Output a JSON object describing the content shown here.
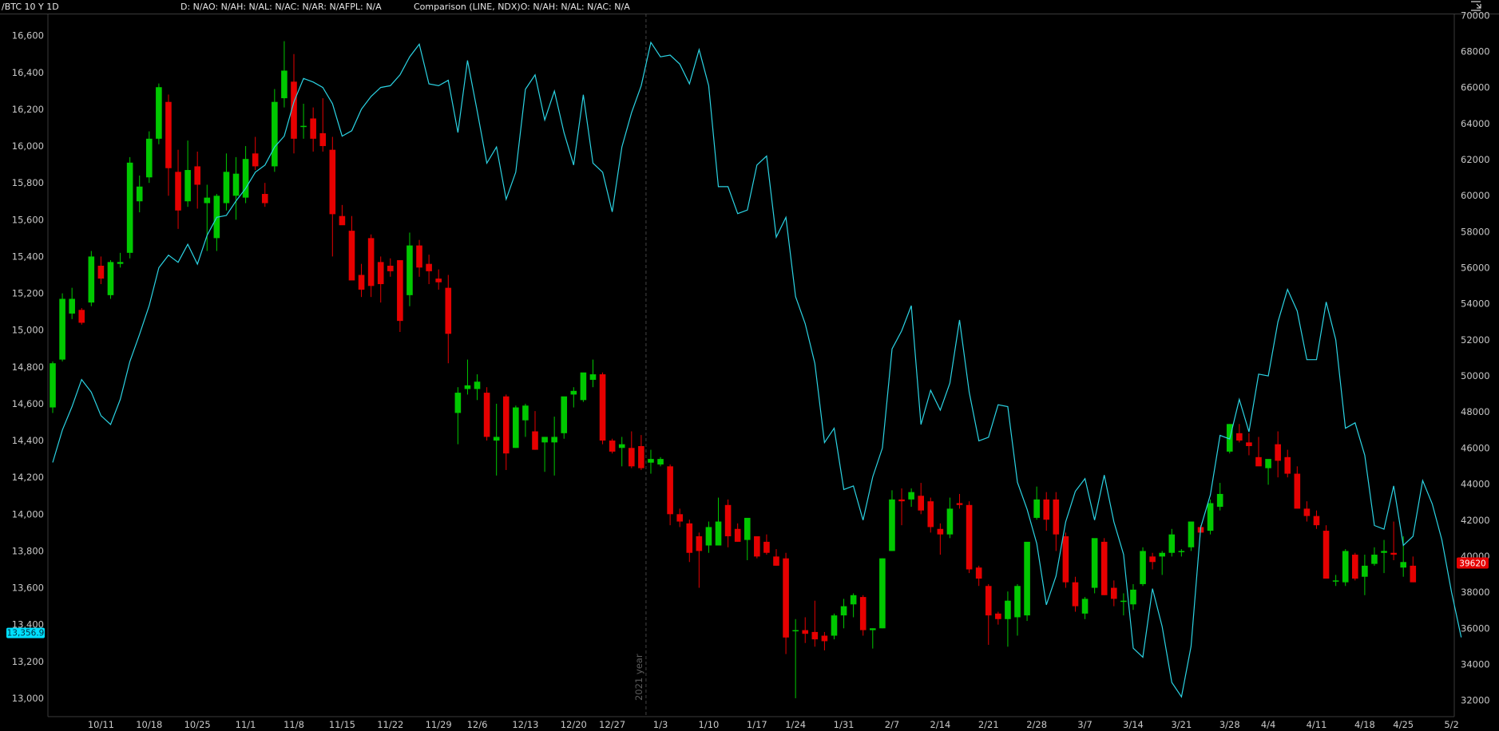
{
  "header": {
    "symbol": "/BTC 10 Y 1D",
    "study": "D: N/AO: N/AH: N/AL: N/AC: N/AR: N/AFPL: N/A",
    "comparison": "Comparison (LINE, NDX)O: N/AH: N/AL: N/AC: N/A",
    "menu_icon": "collapse-corner-icon"
  },
  "colors": {
    "up": "#00c800",
    "down": "#e60000",
    "comparison_line": "#2bd3e3",
    "axis": "#3a3a3a",
    "divider": "#444444",
    "left_badge": "#00e0ff",
    "right_badge": "#e60000"
  },
  "badges": {
    "left_price": "13,356.9",
    "right_price": "39620"
  },
  "divider_label": "2021 year",
  "chart_data": {
    "type": "candlestick",
    "title": "",
    "left_axis": {
      "ticks": [
        "16,600",
        "16,400",
        "16,200",
        "16,000",
        "15,800",
        "15,600",
        "15,400",
        "15,200",
        "15,000",
        "14,800",
        "14,600",
        "14,400",
        "14,200",
        "14,000",
        "13,800",
        "13,600",
        "13,400",
        "13,200",
        "13,000"
      ],
      "range": [
        12900,
        16720
      ]
    },
    "right_axis": {
      "ticks": [
        "70000",
        "68000",
        "66000",
        "64000",
        "62000",
        "60000",
        "58000",
        "56000",
        "54000",
        "52000",
        "50000",
        "48000",
        "46000",
        "44000",
        "42000",
        "40000",
        "38000",
        "36000",
        "34000",
        "32000"
      ],
      "range": [
        31100,
        70100
      ]
    },
    "x_axis": {
      "labels": [
        "10/11",
        "10/18",
        "10/25",
        "11/1",
        "11/8",
        "11/15",
        "11/22",
        "11/29",
        "12/6",
        "12/13",
        "12/20",
        "12/27",
        "1/3",
        "1/10",
        "1/17",
        "1/24",
        "1/31",
        "2/7",
        "2/14",
        "2/21",
        "2/28",
        "3/7",
        "3/14",
        "3/21",
        "3/28",
        "4/4",
        "4/11",
        "4/18",
        "4/25",
        "5/2"
      ],
      "label_bar_index": [
        5,
        10,
        15,
        20,
        25,
        30,
        35,
        40,
        44,
        49,
        54,
        58,
        63,
        68,
        73,
        77,
        82,
        87,
        92,
        97,
        102,
        107,
        112,
        117,
        122,
        126,
        131,
        136,
        140,
        145
      ]
    },
    "series": [
      {
        "name": "/BTC 10 Y 1D",
        "kind": "candlestick",
        "ohlc": [
          [
            14580,
            14830,
            14550,
            14820
          ],
          [
            14840,
            15200,
            14830,
            15170
          ],
          [
            15090,
            15230,
            15060,
            15170
          ],
          [
            15110,
            15120,
            15030,
            15040
          ],
          [
            15150,
            15430,
            15130,
            15400
          ],
          [
            15350,
            15400,
            15250,
            15280
          ],
          [
            15190,
            15380,
            15170,
            15370
          ],
          [
            15360,
            15420,
            15340,
            15370
          ],
          [
            15420,
            15940,
            15390,
            15910
          ],
          [
            15700,
            15840,
            15640,
            15780
          ],
          [
            15830,
            16080,
            15800,
            16040
          ],
          [
            16040,
            16340,
            16010,
            16320
          ],
          [
            16240,
            16280,
            15730,
            15880
          ],
          [
            15860,
            15980,
            15550,
            15650
          ],
          [
            15700,
            16030,
            15670,
            15870
          ],
          [
            15890,
            15970,
            15660,
            15790
          ],
          [
            15690,
            15790,
            15430,
            15720
          ],
          [
            15500,
            15740,
            15430,
            15730
          ],
          [
            15690,
            15960,
            15650,
            15860
          ],
          [
            15730,
            15940,
            15600,
            15850
          ],
          [
            15720,
            16000,
            15690,
            15930
          ],
          [
            15960,
            16050,
            15870,
            15890
          ],
          [
            15740,
            15800,
            15670,
            15690
          ],
          [
            15890,
            16310,
            15860,
            16240
          ],
          [
            16260,
            16570,
            16210,
            16410
          ],
          [
            16350,
            16500,
            15960,
            16040
          ],
          [
            16110,
            16230,
            16040,
            16110
          ],
          [
            16150,
            16210,
            15970,
            16040
          ],
          [
            16070,
            16260,
            15970,
            16000
          ],
          [
            15980,
            16050,
            15400,
            15630
          ],
          [
            15620,
            15680,
            15580,
            15570
          ],
          [
            15540,
            15620,
            15300,
            15270
          ],
          [
            15300,
            15360,
            15180,
            15220
          ],
          [
            15500,
            15520,
            15180,
            15240
          ],
          [
            15370,
            15400,
            15150,
            15250
          ],
          [
            15350,
            15390,
            15290,
            15320
          ],
          [
            15380,
            15380,
            14990,
            15050
          ],
          [
            15190,
            15530,
            15130,
            15460
          ],
          [
            15460,
            15490,
            15290,
            15340
          ],
          [
            15360,
            15410,
            15250,
            15320
          ],
          [
            15280,
            15330,
            15220,
            15260
          ],
          [
            15230,
            15300,
            14820,
            14980
          ],
          [
            14550,
            14690,
            14380,
            14660
          ],
          [
            14680,
            14840,
            14650,
            14700
          ],
          [
            14680,
            14760,
            14620,
            14720
          ],
          [
            14660,
            14690,
            14400,
            14420
          ],
          [
            14400,
            14600,
            14210,
            14420
          ],
          [
            14640,
            14650,
            14240,
            14330
          ],
          [
            14360,
            14590,
            14360,
            14580
          ],
          [
            14510,
            14600,
            14420,
            14590
          ],
          [
            14450,
            14560,
            14350,
            14350
          ],
          [
            14390,
            14420,
            14230,
            14420
          ],
          [
            14390,
            14530,
            14210,
            14420
          ],
          [
            14440,
            14620,
            14410,
            14640
          ],
          [
            14650,
            14690,
            14580,
            14670
          ],
          [
            14620,
            14760,
            14610,
            14770
          ],
          [
            14730,
            14840,
            14690,
            14760
          ],
          [
            14760,
            14770,
            14380,
            14400
          ],
          [
            14400,
            14410,
            14330,
            14340
          ],
          [
            14360,
            14420,
            14260,
            14380
          ],
          [
            14360,
            14450,
            14250,
            14260
          ],
          [
            14370,
            14430,
            14240,
            14250
          ],
          [
            14280,
            14350,
            14220,
            14300
          ],
          [
            14270,
            14310,
            14260,
            14300
          ],
          [
            14260,
            14270,
            13940,
            14000
          ],
          [
            14000,
            14030,
            13930,
            13960
          ],
          [
            13950,
            13970,
            13740,
            13790
          ],
          [
            13880,
            13900,
            13600,
            13800
          ],
          [
            13830,
            13960,
            13790,
            13930
          ],
          [
            13830,
            14090,
            13830,
            13960
          ],
          [
            14050,
            14080,
            13820,
            13880
          ],
          [
            13920,
            13950,
            13850,
            13850
          ],
          [
            13860,
            13950,
            13750,
            13980
          ],
          [
            13880,
            13880,
            13760,
            13770
          ],
          [
            13850,
            13890,
            13780,
            13790
          ],
          [
            13770,
            13810,
            13720,
            13720
          ],
          [
            13760,
            13790,
            13240,
            13330
          ],
          [
            13370,
            13430,
            13000,
            13370
          ],
          [
            13370,
            13440,
            13300,
            13350
          ],
          [
            13360,
            13530,
            13280,
            13320
          ],
          [
            13340,
            13360,
            13260,
            13310
          ],
          [
            13340,
            13460,
            13320,
            13450
          ],
          [
            13450,
            13540,
            13380,
            13500
          ],
          [
            13510,
            13570,
            13440,
            13560
          ],
          [
            13550,
            13560,
            13340,
            13370
          ],
          [
            13370,
            13380,
            13270,
            13380
          ],
          [
            13380,
            13760,
            13380,
            13760
          ],
          [
            13800,
            14130,
            13800,
            14080
          ],
          [
            14080,
            14140,
            13940,
            14070
          ],
          [
            14080,
            14140,
            14040,
            14120
          ],
          [
            14100,
            14170,
            14000,
            14020
          ],
          [
            14070,
            14090,
            13900,
            13930
          ],
          [
            13920,
            13950,
            13780,
            13890
          ],
          [
            13890,
            14090,
            13870,
            14030
          ],
          [
            14060,
            14110,
            14030,
            14050
          ],
          [
            14050,
            14070,
            13680,
            13700
          ],
          [
            13710,
            13720,
            13610,
            13650
          ],
          [
            13610,
            13620,
            13290,
            13450
          ],
          [
            13460,
            13470,
            13400,
            13430
          ],
          [
            13430,
            13580,
            13280,
            13530
          ],
          [
            13440,
            13620,
            13340,
            13610
          ],
          [
            13450,
            13840,
            13420,
            13850
          ],
          [
            13980,
            14150,
            13970,
            14080
          ],
          [
            14080,
            14120,
            13910,
            13970
          ],
          [
            14080,
            14120,
            13800,
            13890
          ],
          [
            13880,
            13900,
            13600,
            13630
          ],
          [
            13630,
            13660,
            13470,
            13500
          ],
          [
            13460,
            13550,
            13430,
            13540
          ],
          [
            13600,
            13850,
            13570,
            13870
          ],
          [
            13850,
            13870,
            13560,
            13560
          ],
          [
            13600,
            13640,
            13500,
            13540
          ],
          [
            13530,
            13570,
            13450,
            13530
          ],
          [
            13510,
            13620,
            13480,
            13590
          ],
          [
            13620,
            13820,
            13610,
            13800
          ],
          [
            13770,
            13790,
            13700,
            13740
          ],
          [
            13770,
            13800,
            13670,
            13790
          ],
          [
            13790,
            13920,
            13770,
            13890
          ],
          [
            13800,
            13810,
            13770,
            13800
          ],
          [
            13820,
            13950,
            13800,
            13960
          ],
          [
            13930,
            13940,
            13900,
            13900
          ],
          [
            13910,
            14080,
            13890,
            14060
          ],
          [
            14040,
            14170,
            14020,
            14110
          ],
          [
            14340,
            14490,
            14330,
            14490
          ],
          [
            14440,
            14490,
            14390,
            14400
          ],
          [
            14390,
            14440,
            14320,
            14370
          ],
          [
            14310,
            14420,
            14300,
            14260
          ],
          [
            14250,
            14260,
            14160,
            14300
          ],
          [
            14380,
            14450,
            14200,
            14290
          ],
          [
            14310,
            14350,
            14200,
            14220
          ],
          [
            14220,
            14260,
            14040,
            14030
          ],
          [
            14030,
            14070,
            13960,
            13990
          ],
          [
            13990,
            14020,
            13920,
            13940
          ],
          [
            13910,
            13940,
            13660,
            13650
          ],
          [
            13640,
            13670,
            13610,
            13640
          ],
          [
            13630,
            13810,
            13610,
            13800
          ],
          [
            13780,
            13790,
            13640,
            13650
          ],
          [
            13660,
            13780,
            13560,
            13720
          ],
          [
            13730,
            13820,
            13720,
            13780
          ],
          [
            13790,
            13860,
            13680,
            13800
          ],
          [
            13790,
            13960,
            13750,
            13780
          ],
          [
            13710,
            13880,
            13660,
            13740
          ],
          [
            13720,
            13770,
            13630,
            13630
          ]
        ]
      },
      {
        "name": "NDX",
        "kind": "line",
        "values": [
          45200,
          47000,
          48300,
          49800,
          49100,
          47800,
          47300,
          48700,
          50800,
          52300,
          53900,
          56000,
          56700,
          56300,
          57300,
          56200,
          57800,
          58800,
          58900,
          59700,
          60400,
          61300,
          61700,
          62700,
          63300,
          65200,
          66500,
          66300,
          66000,
          65100,
          63300,
          63600,
          64800,
          65500,
          66000,
          66100,
          66700,
          67700,
          68400,
          66200,
          66100,
          66400,
          63500,
          67500,
          64700,
          61800,
          62700,
          59800,
          61300,
          65900,
          66700,
          64200,
          65800,
          63500,
          61700,
          65600,
          61800,
          61300,
          59100,
          62700,
          64600,
          66100,
          68500,
          67700,
          67800,
          67300,
          66200,
          68100,
          66100,
          60500,
          60500,
          59000,
          59200,
          61700,
          62200,
          57700,
          58800,
          54400,
          52900,
          50700,
          46300,
          47100,
          43700,
          43900,
          42000,
          44400,
          46000,
          51500,
          52500,
          53900,
          47300,
          49200,
          48100,
          49600,
          53100,
          49100,
          46400,
          46600,
          48400,
          48300,
          44100,
          42600,
          40700,
          37300,
          38900,
          41900,
          43600,
          44300,
          42000,
          44500,
          41900,
          40100,
          34900,
          34400,
          38200,
          36100,
          33000,
          32200,
          35000,
          41600,
          43400,
          46700,
          46500,
          48700,
          46900,
          50100,
          50000,
          53000,
          54800,
          53600,
          50900,
          50900,
          54100,
          52000,
          47100,
          47400,
          45600,
          41700,
          41500,
          43900,
          40600,
          41100,
          44200,
          42900,
          40900,
          38000,
          35500
        ]
      }
    ]
  }
}
